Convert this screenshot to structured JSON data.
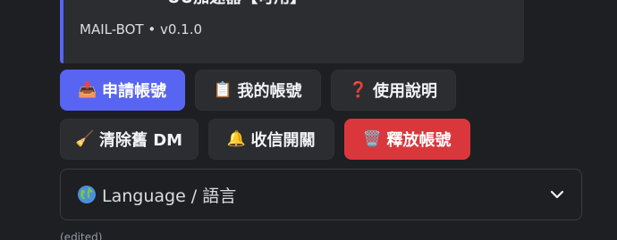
{
  "embed": {
    "cut_line": "UU加速器【可用】",
    "footer": "MAIL-BOT • v0.1.0",
    "accent_color": "#5865f2"
  },
  "buttons": [
    {
      "label": "申請帳號",
      "icon": "inbox-tray-icon",
      "glyph": "📥",
      "style": "primary"
    },
    {
      "label": "我的帳號",
      "icon": "clipboard-icon",
      "glyph": "📋",
      "style": "secondary"
    },
    {
      "label": "使用說明",
      "icon": "question-mark-icon",
      "glyph": "❓",
      "style": "secondary"
    },
    {
      "label": "清除舊 DM",
      "icon": "broom-icon",
      "glyph": "🧹",
      "style": "secondary"
    },
    {
      "label": "收信開關",
      "icon": "bell-icon",
      "glyph": "🔔",
      "style": "secondary"
    },
    {
      "label": "釋放帳號",
      "icon": "wastebasket-icon",
      "glyph": "🗑️",
      "style": "danger"
    }
  ],
  "language_select": {
    "placeholder": "Language / 語言",
    "icon": "globe-icon"
  },
  "message_edited": "(edited)",
  "colors": {
    "primary": "#5865f2",
    "danger": "#da373c",
    "secondary": "#2b2d31",
    "background": "#1e1f22"
  }
}
